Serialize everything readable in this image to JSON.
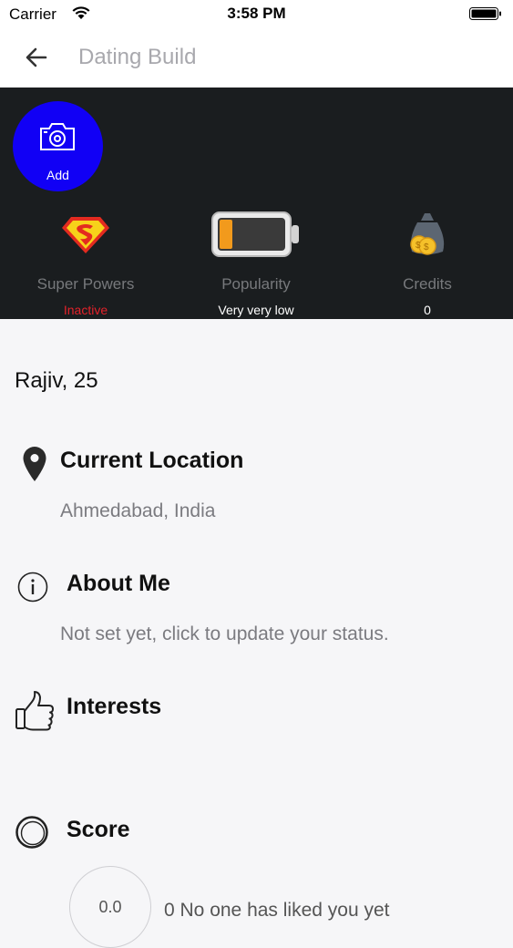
{
  "status_bar": {
    "carrier": "Carrier",
    "time": "3:58 PM"
  },
  "nav": {
    "title": "Dating Build",
    "back_icon": "arrow-left-icon"
  },
  "header": {
    "add_photo_label": "Add",
    "stats": [
      {
        "title": "Super Powers",
        "value": "Inactive",
        "icon": "superman-icon",
        "value_color": "#e3222a"
      },
      {
        "title": "Popularity",
        "value": "Very very low",
        "icon": "battery-low-icon"
      },
      {
        "title": "Credits",
        "value": "0",
        "icon": "money-bag-icon"
      }
    ]
  },
  "profile": {
    "name": "Rajiv, 25",
    "location": {
      "title": "Current Location",
      "value": "Ahmedabad, India",
      "icon": "map-pin-icon"
    },
    "about": {
      "title": "About Me",
      "value": "Not set yet, click to update your status.",
      "icon": "info-icon"
    },
    "interests": {
      "title": "Interests",
      "icon": "thumbs-up-icon"
    },
    "score": {
      "title": "Score",
      "value": "0.0",
      "likes_text": "0  No one has liked you yet",
      "icon": "ring-icon"
    }
  },
  "colors": {
    "accent_blue": "#1100f5",
    "header_bg": "#1a1d1f",
    "inactive_red": "#e3222a"
  }
}
